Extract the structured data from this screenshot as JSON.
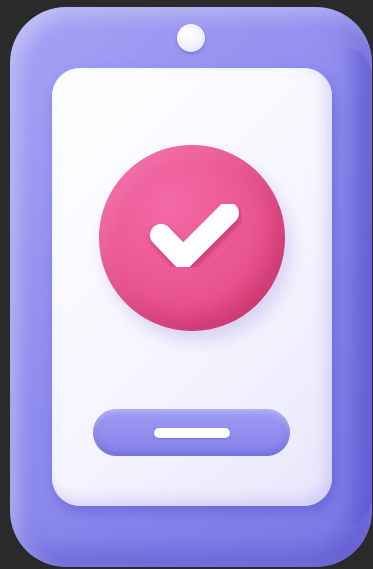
{
  "illustration": {
    "subject": "phone-with-checkmark",
    "colors": {
      "shell": "#8f8cee",
      "shell_highlight": "#a6a3f4",
      "screen": "#f6f5ff",
      "badge": "#e9548f",
      "check": "#ffffff",
      "home_bar": "#9d9af2"
    },
    "icons": {
      "badge_icon": "checkmark-icon",
      "camera": "camera-dot-icon"
    }
  }
}
